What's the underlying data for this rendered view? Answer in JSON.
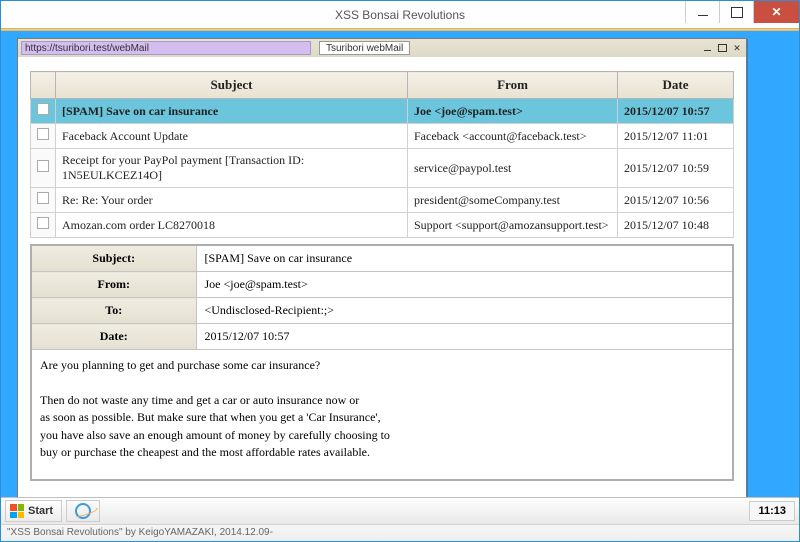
{
  "outer_window": {
    "title": "XSS Bonsai Revolutions"
  },
  "browser": {
    "url": "https://tsuribori.test/webMail",
    "tab_title": "Tsuribori webMail"
  },
  "headers": {
    "subject": "Subject",
    "from": "From",
    "date": "Date"
  },
  "mails": [
    {
      "subject": "[SPAM] Save on car insurance",
      "from": "Joe <joe@spam.test>",
      "date": "2015/12/07 10:57",
      "selected": true
    },
    {
      "subject": "Faceback Account Update",
      "from": "Faceback <account@faceback.test>",
      "date": "2015/12/07 11:01",
      "selected": false
    },
    {
      "subject": "Receipt for your PayPol payment [Transaction ID: 1N5EULKCEZ14O]",
      "from": "service@paypol.test",
      "date": "2015/12/07 10:59",
      "selected": false
    },
    {
      "subject": "Re: Re: Your order",
      "from": "president@someCompany.test",
      "date": "2015/12/07 10:56",
      "selected": false
    },
    {
      "subject": "Amozan.com order LC8270018",
      "from": "Support <support@amozansupport.test>",
      "date": "2015/12/07 10:48",
      "selected": false
    }
  ],
  "detail": {
    "labels": {
      "subject": "Subject:",
      "from": "From:",
      "to": "To:",
      "date": "Date:"
    },
    "subject": "[SPAM] Save on car insurance",
    "from": "Joe <joe@spam.test>",
    "to": "<Undisclosed-Recipient:;>",
    "date": "2015/12/07 10:57",
    "body": "Are you planning to get and purchase some car insurance?\n\nThen do not waste any time and get a car or auto insurance now or\nas soon as possible. But make sure that when you get a 'Car Insurance',\nyou have also save an enough amount of money by carefully choosing to\nbuy or purchase the cheapest and the most affordable rates available."
  },
  "taskbar": {
    "start": "Start",
    "clock": "11:13"
  },
  "statusbar": "\"XSS Bonsai Revolutions\" by KeigoYAMAZAKI, 2014.12.09-"
}
